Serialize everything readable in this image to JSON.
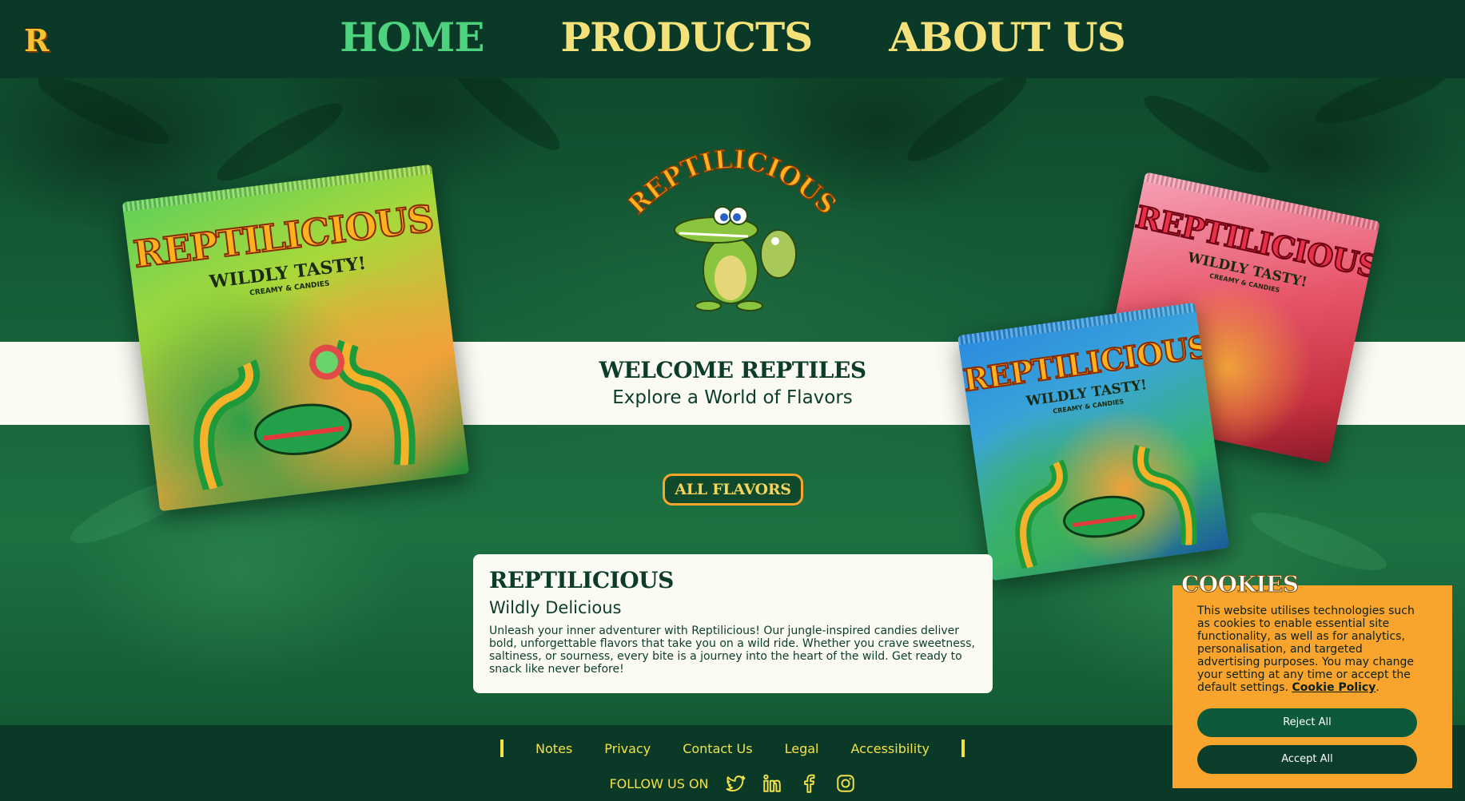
{
  "nav": {
    "logo_letter": "R",
    "links": [
      {
        "label": "HOME",
        "active": true
      },
      {
        "label": "PRODUCTS",
        "active": false
      },
      {
        "label": "ABOUT US",
        "active": false
      }
    ]
  },
  "hero": {
    "emblem_text": "REPTILICIOUS",
    "welcome_title": "WELCOME REPTILES",
    "welcome_subtitle": "Explore a World of Flavors",
    "cta_label": "ALL FLAVORS",
    "packs": [
      {
        "brand": "REPTILICIOUS",
        "tagline": "WILDLY TASTY!",
        "subline": "CREAMY & CANDIES"
      },
      {
        "brand": "REPTILICIOUS",
        "tagline": "WILDLY TASTY!",
        "subline": "CREAMY & CANDIES"
      },
      {
        "brand": "REPTILICIOUS",
        "tagline": "WILDLY TASTY!",
        "subline": "CREAMY & CANDIES"
      }
    ]
  },
  "card": {
    "title": "REPTILICIOUS",
    "subtitle": "Wildly Delicious",
    "body": "Unleash your inner adventurer with Reptilicious! Our jungle-inspired candies deliver bold, unforgettable flavors that take you on a wild ride. Whether you crave sweetness, saltiness, or sourness, every bite is a journey into the heart of the wild. Get ready to snack like never before!"
  },
  "footer": {
    "links": [
      "Notes",
      "Privacy",
      "Contact Us",
      "Legal",
      "Accessibility"
    ],
    "follow_label": "FOLLOW US ON",
    "socials": [
      "twitter-icon",
      "linkedin-icon",
      "facebook-icon",
      "instagram-icon"
    ]
  },
  "cookie": {
    "title": "COOKIES",
    "text": "This website utilises technologies such as cookies to enable essential site functionality, as well as for analytics, personalisation, and targeted advertising purposes. You may change your setting at any time or accept the default settings.",
    "link_label": "Cookie Policy",
    "reject_label": "Reject All",
    "accept_label": "Accept All"
  },
  "colors": {
    "nav_bg": "#0a3a27",
    "nav_active": "#4dd27e",
    "nav_link": "#f4e17a",
    "accent_orange": "#f9a52d",
    "dark_green": "#0b3d2a"
  }
}
